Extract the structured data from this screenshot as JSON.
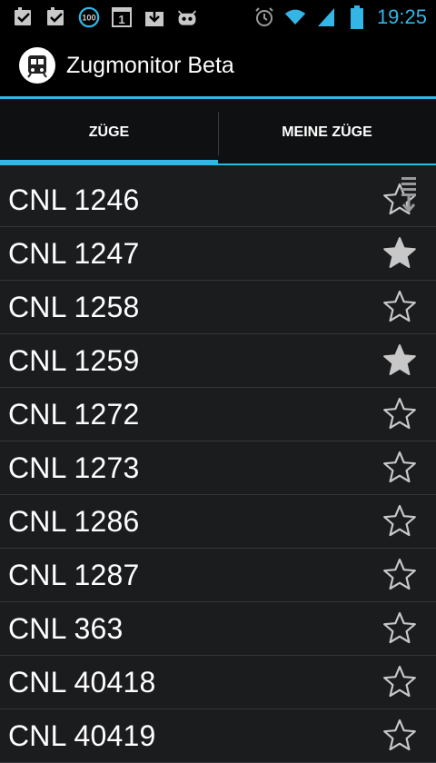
{
  "status_bar": {
    "time": "19:25",
    "battery_level": "100",
    "notification_count": "1",
    "icons": [
      "check-box-icon",
      "check-box-icon",
      "battery-100-icon",
      "calendar-1-icon",
      "download-icon",
      "cyanogen-robot-icon"
    ],
    "right_icons": [
      "alarm-icon",
      "wifi-icon",
      "signal-icon",
      "battery-icon"
    ]
  },
  "action_bar": {
    "title": "Zugmonitor Beta",
    "app_icon": "tram-icon"
  },
  "tabs": [
    {
      "label": "ZÜGE",
      "selected": true
    },
    {
      "label": "MEINE ZÜGE",
      "selected": false
    }
  ],
  "trains": [
    {
      "name": "CNL 1246",
      "favorite": false
    },
    {
      "name": "CNL 1247",
      "favorite": true
    },
    {
      "name": "CNL 1258",
      "favorite": false
    },
    {
      "name": "CNL 1259",
      "favorite": true
    },
    {
      "name": "CNL 1272",
      "favorite": false
    },
    {
      "name": "CNL 1273",
      "favorite": false
    },
    {
      "name": "CNL 1286",
      "favorite": false
    },
    {
      "name": "CNL 1287",
      "favorite": false
    },
    {
      "name": "CNL 363",
      "favorite": false
    },
    {
      "name": "CNL 40418",
      "favorite": false
    },
    {
      "name": "CNL 40419",
      "favorite": false
    }
  ],
  "colors": {
    "accent": "#33b5e5",
    "star_filled": "#c8c8c8",
    "star_outline": "#c8c8c8"
  }
}
